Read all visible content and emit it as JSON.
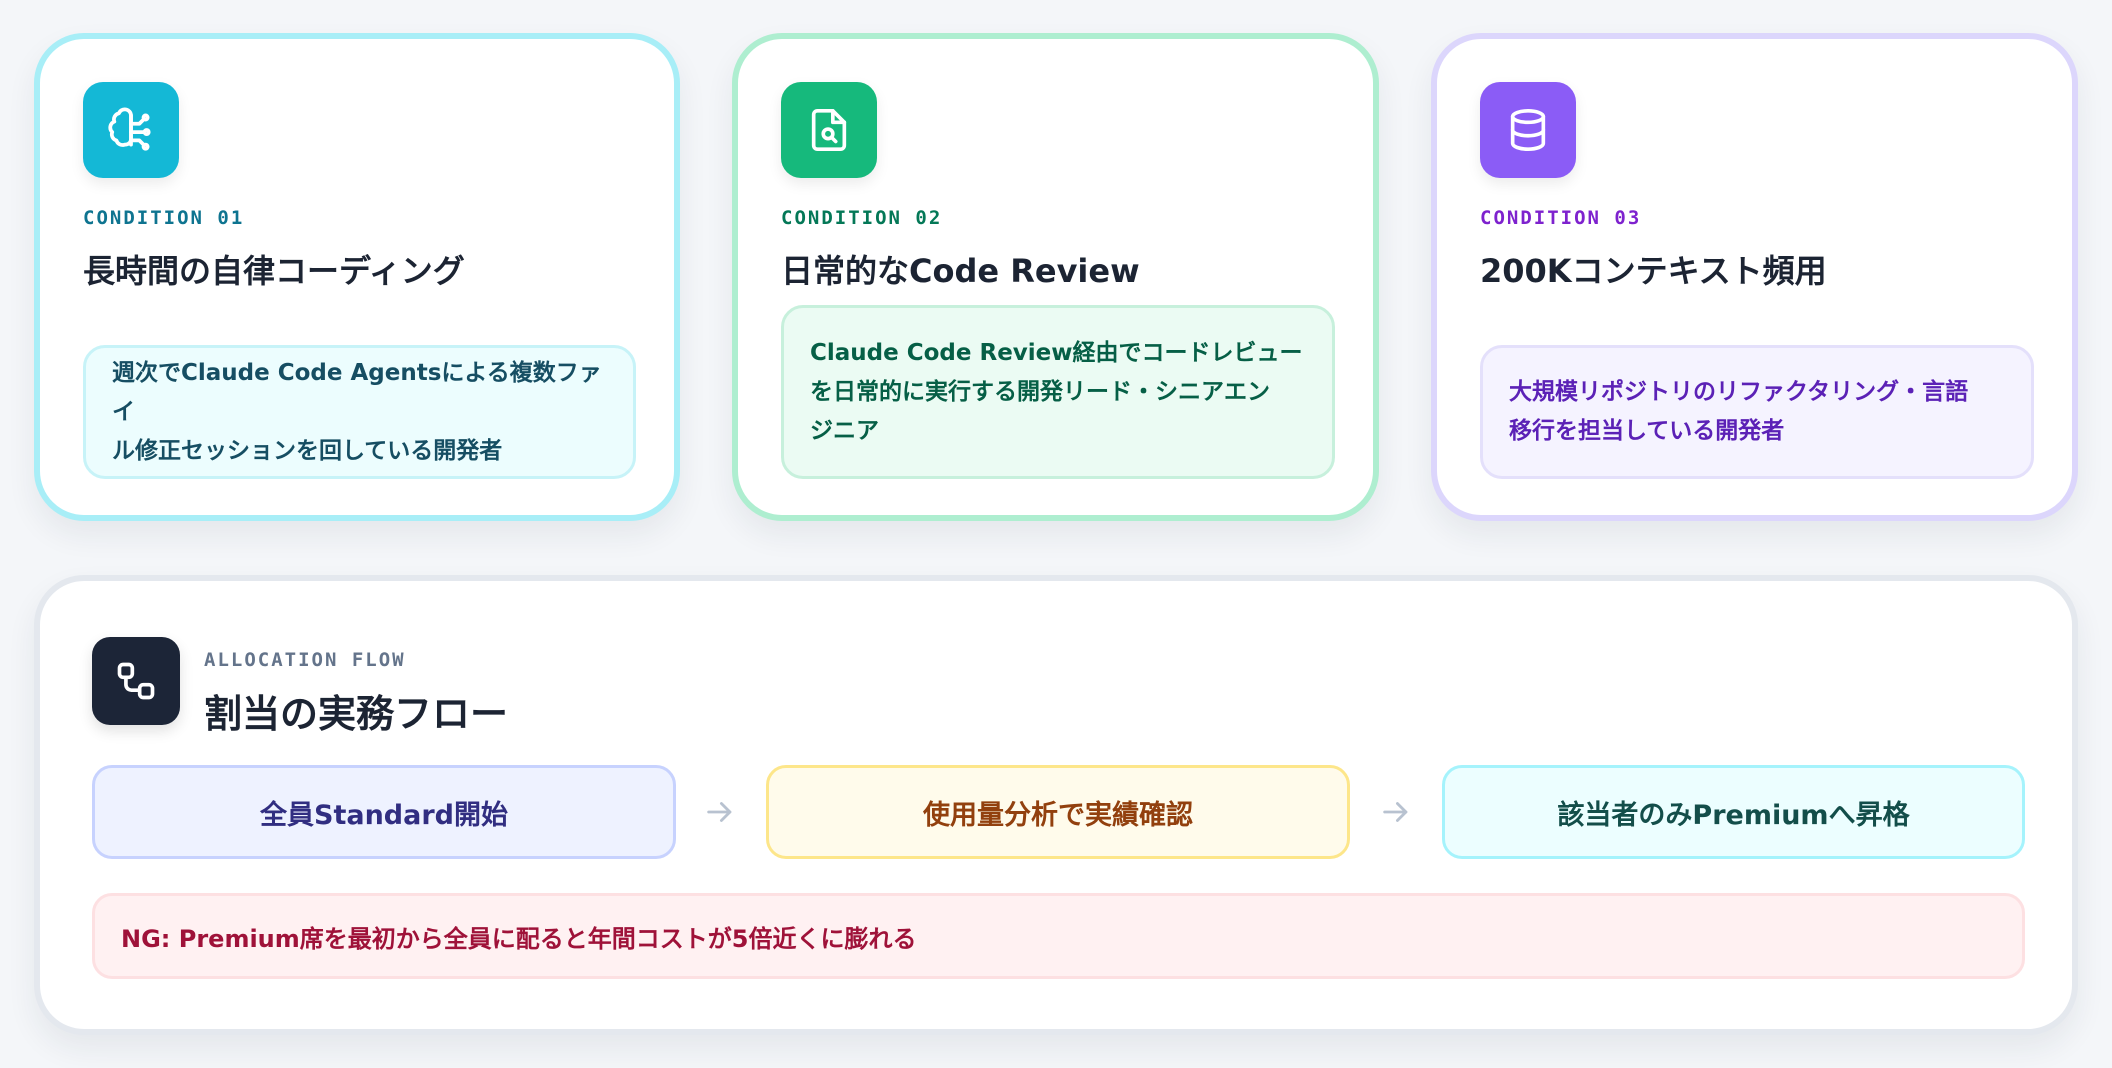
{
  "conditions": [
    {
      "icon": "brain-icon",
      "label": "CONDITION 01",
      "title": "長時間の自律コーディング",
      "desc_lines": [
        "週次でClaude Code Agentsによる複数ファイ",
        "ル修正セッションを回している開発者"
      ],
      "accent": "#14b8d6"
    },
    {
      "icon": "file-search-icon",
      "label": "CONDITION 02",
      "title": "日常的なCode Review",
      "desc_lines": [
        "Claude Code Review経由でコードレビュー",
        "を日常的に実行する開発リード・シニアエン",
        "ジニア"
      ],
      "accent": "#16b97c"
    },
    {
      "icon": "database-icon",
      "label": "CONDITION 03",
      "title": "200Kコンテキスト頻用",
      "desc_lines": [
        "大規模リポジトリのリファクタリング・言語",
        "移行を担当している開発者"
      ],
      "accent": "#8b5cf6"
    }
  ],
  "flow": {
    "icon": "workflow-icon",
    "eyebrow": "ALLOCATION FLOW",
    "title": "割当の実務フロー",
    "steps": [
      "全員Standard開始",
      "使用量分析で実績確認",
      "該当者のみPremiumへ昇格"
    ],
    "arrow_icon": "arrow-right-icon",
    "warning": "NG: Premium席を最初から全員に配ると年間コストが5倍近くに膨れる"
  }
}
